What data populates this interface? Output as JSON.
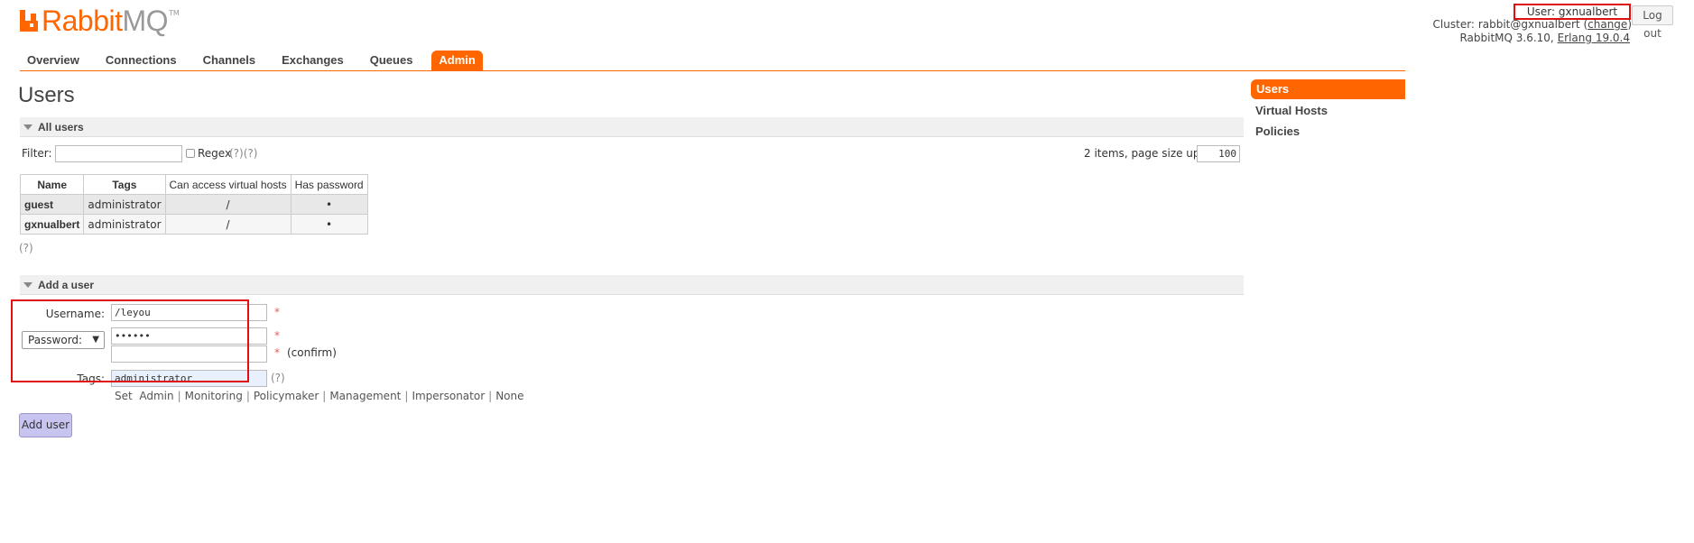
{
  "logo": {
    "name_part1": "Rabbit",
    "name_part2": "MQ",
    "trademark": "TM"
  },
  "header": {
    "user_label": "User:",
    "user_name": "gxnualbert",
    "logout_label": "Log out",
    "cluster_label": "Cluster:",
    "cluster_name": "rabbit@gxnualbert",
    "change_label": "change",
    "version_text": "RabbitMQ 3.6.10,",
    "erlang_text": "Erlang 19.0.4"
  },
  "tabs": [
    {
      "label": "Overview"
    },
    {
      "label": "Connections"
    },
    {
      "label": "Channels"
    },
    {
      "label": "Exchanges"
    },
    {
      "label": "Queues"
    },
    {
      "label": "Admin",
      "active": true
    }
  ],
  "sidebar": {
    "items": [
      {
        "label": "Users",
        "active": true
      },
      {
        "label": "Virtual Hosts"
      },
      {
        "label": "Policies"
      }
    ]
  },
  "main": {
    "title": "Users",
    "all_users_section": "All users",
    "filter_label": "Filter:",
    "filter_value": "",
    "regex_label": "Regex",
    "regex_help": "(?)(?)",
    "items_count_text": "2 items, page size up to",
    "page_size": "100",
    "table": {
      "headers": [
        "Name",
        "Tags",
        "Can access virtual hosts",
        "Has password"
      ],
      "rows": [
        {
          "name": "guest",
          "tags": "administrator",
          "vhosts": "/",
          "has_password": "•"
        },
        {
          "name": "gxnualbert",
          "tags": "administrator",
          "vhosts": "/",
          "has_password": "•"
        }
      ]
    },
    "table_help": "(?)",
    "add_user_section": "Add a user",
    "form": {
      "username_label": "Username:",
      "username_value": "/leyou",
      "password_option": "Password:",
      "password_value": "••••••",
      "confirm_value": "",
      "confirm_label": "(confirm)",
      "required_mark": "*",
      "tags_label": "Tags:",
      "tags_value": "administrator",
      "tags_help": "(?)",
      "set_label": "Set",
      "tag_options": [
        "Admin",
        "Monitoring",
        "Policymaker",
        "Management",
        "Impersonator",
        "None"
      ],
      "submit_label": "Add user"
    }
  },
  "colors": {
    "accent": "#ff6600",
    "highlight_box": "#e01010",
    "button_bg": "#c8c4f0"
  }
}
